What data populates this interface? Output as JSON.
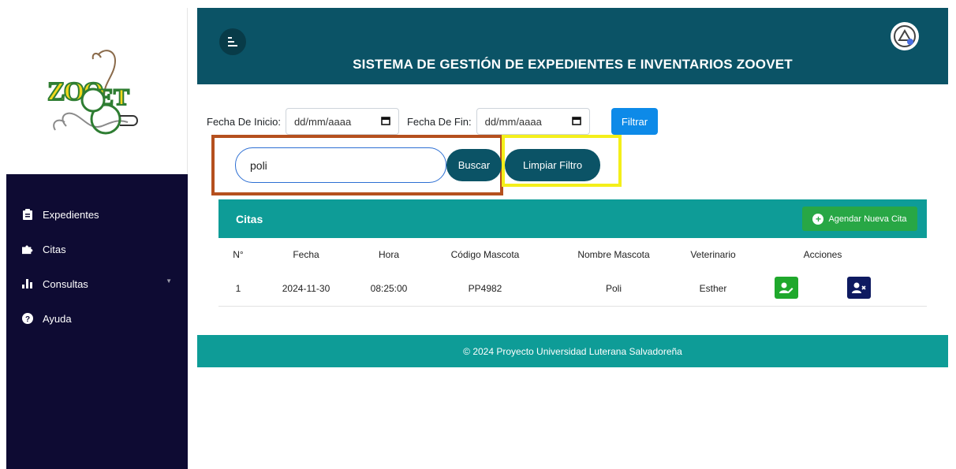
{
  "header": {
    "title": "SISTEMA DE GESTIÓN DE EXPEDIENTES E INVENTARIOS ZOOVET"
  },
  "logo": {
    "text": "ZOOVET"
  },
  "sidebar": {
    "items": [
      {
        "label": "Expedientes",
        "icon": "clipboard-icon"
      },
      {
        "label": "Citas",
        "icon": "puzzle-icon"
      },
      {
        "label": "Consultas",
        "icon": "bar-chart-icon",
        "has_caret": true
      },
      {
        "label": "Ayuda",
        "icon": "question-icon"
      }
    ]
  },
  "filters": {
    "start_label": "Fecha De Inicio:",
    "start_placeholder": "dd/mm/aaaa",
    "end_label": "Fecha De Fin:",
    "end_placeholder": "dd/mm/aaaa",
    "filter_button": "Filtrar",
    "search_value": "poli",
    "search_button": "Buscar",
    "clear_button": "Limpiar Filtro"
  },
  "card": {
    "title": "Citas",
    "new_button": "Agendar Nueva Cita",
    "columns": [
      "N°",
      "Fecha",
      "Hora",
      "Código Mascota",
      "Nombre Mascota",
      "Veterinario",
      "Acciones"
    ],
    "rows": [
      {
        "n": "1",
        "fecha": "2024-11-30",
        "hora": "08:25:00",
        "codigo": "PP4982",
        "nombre": "Poli",
        "veterinario": "Esther"
      }
    ]
  },
  "footer": {
    "text": "© 2024 Proyecto Universidad Luterana Salvadoreña"
  },
  "colors": {
    "header": "#0b5366",
    "sidebar": "#0e0b33",
    "teal": "#0e9c97",
    "green": "#28a745",
    "highlight_search": "#b5501e",
    "highlight_clear": "#f4ef1a"
  }
}
